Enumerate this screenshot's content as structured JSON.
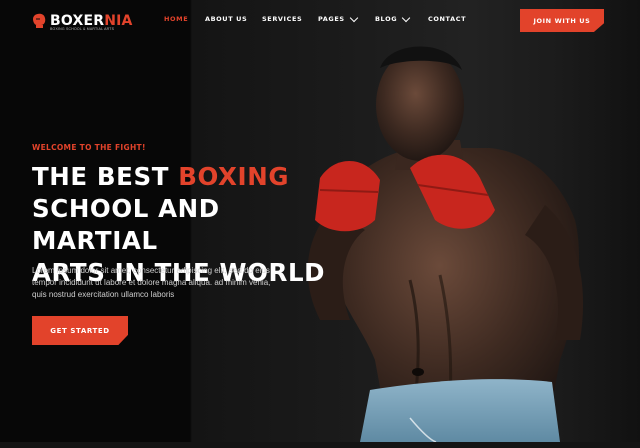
{
  "brand": {
    "name_part1": "BOXER",
    "name_part2": "NIA",
    "tagline": "BOXING SCHOOL & MARTIAL ARTS"
  },
  "nav": {
    "items": [
      {
        "label": "HOME",
        "active": true,
        "has_dropdown": false
      },
      {
        "label": "ABOUT US",
        "active": false,
        "has_dropdown": false
      },
      {
        "label": "SERVICES",
        "active": false,
        "has_dropdown": false
      },
      {
        "label": "PAGES",
        "active": false,
        "has_dropdown": true
      },
      {
        "label": "BLOG",
        "active": false,
        "has_dropdown": true
      },
      {
        "label": "CONTACT",
        "active": false,
        "has_dropdown": false
      }
    ],
    "join_label": "JOIN WITH US"
  },
  "hero": {
    "welcome": "WELCOME TO THE FIGHT!",
    "headline_prefix": "THE BEST ",
    "headline_accent": "BOXING",
    "headline_line2": "SCHOOL AND MARTIAL",
    "headline_line3": "ARTS IN THE WORLD",
    "description": "Lorem ipsum dolor sit amet, consectetur adipiscing elit, sed do eius tempor incididunt ut labore et dolore magna aliqua. ad minim venia, quis nostrud exercitation ullamco laboris",
    "cta_label": "GET STARTED"
  },
  "colors": {
    "accent": "#e2432b",
    "background": "#070707",
    "text": "#ffffff"
  },
  "icons": [
    "boxing-glove-icon",
    "chevron-down-icon"
  ]
}
